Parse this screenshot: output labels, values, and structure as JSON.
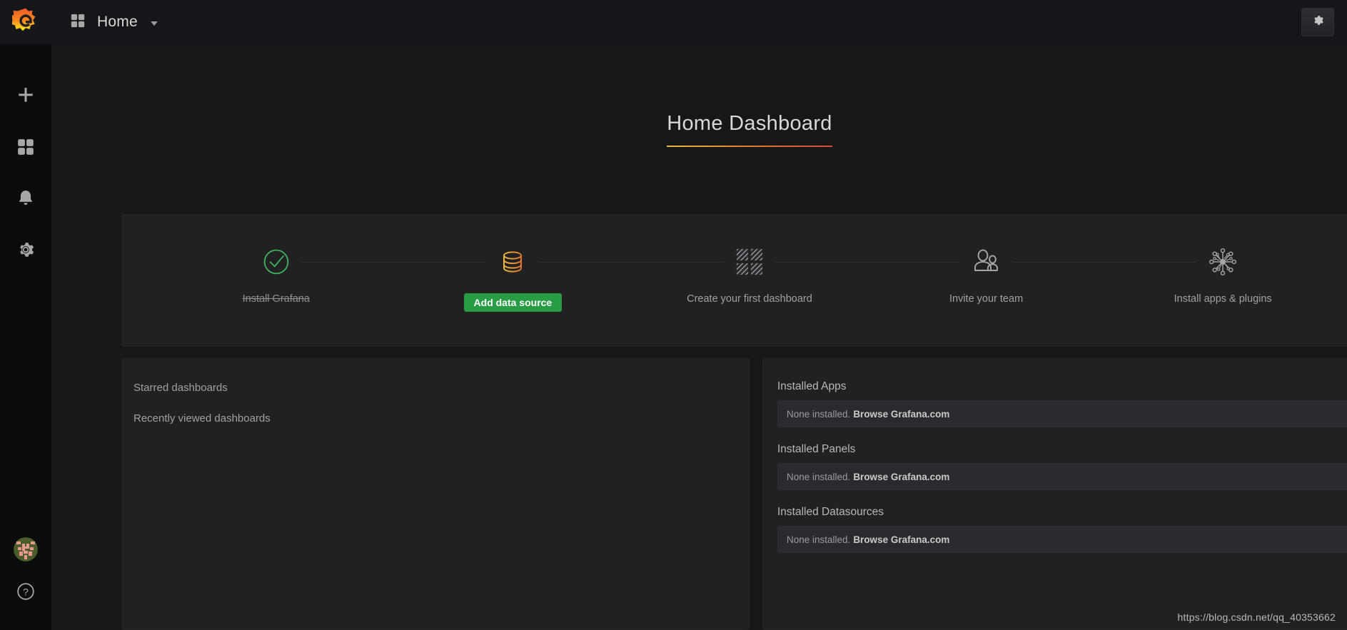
{
  "sidebar": {
    "brand_icon": "grafana-logo",
    "top_items": [
      {
        "icon": "plus-icon",
        "name": "create"
      },
      {
        "icon": "dashboards-grid-icon",
        "name": "dashboards"
      },
      {
        "icon": "bell-icon",
        "name": "alerting"
      },
      {
        "icon": "gear-icon",
        "name": "configuration"
      }
    ],
    "bottom_items": [
      {
        "icon": "user-avatar",
        "name": "profile"
      },
      {
        "icon": "help-question-icon",
        "name": "help"
      }
    ]
  },
  "topbar": {
    "menu_icon": "dashboards-grid-icon",
    "title": "Home",
    "caret_icon": "chevron-down-icon",
    "settings_icon": "gear-icon"
  },
  "title_panel": {
    "title": "Home Dashboard",
    "accent_start": "#eab839",
    "accent_end": "#d44a3a"
  },
  "onboarding": {
    "close_label": "✖",
    "steps": [
      {
        "label": "Install Grafana",
        "icon": "check-circle-icon",
        "state": "done",
        "color": "#3eb15b"
      },
      {
        "label": "Add data source",
        "icon": "database-icon",
        "state": "button",
        "color": "#e8922a"
      },
      {
        "label": "Create your first dashboard",
        "icon": "dashboard-grid-hatched-icon",
        "state": "todo",
        "color": "#a6a7a9"
      },
      {
        "label": "Invite your team",
        "icon": "users-icon",
        "state": "todo",
        "color": "#a6a7a9"
      },
      {
        "label": "Install apps & plugins",
        "icon": "plugins-node-icon",
        "state": "todo",
        "color": "#a6a7a9"
      }
    ]
  },
  "left_panel": {
    "links": [
      "Starred dashboards",
      "Recently viewed dashboards"
    ]
  },
  "right_panel": {
    "sections": [
      {
        "heading": "Installed Apps",
        "text": "None installed.",
        "link": "Browse Grafana.com"
      },
      {
        "heading": "Installed Panels",
        "text": "None installed.",
        "link": "Browse Grafana.com"
      },
      {
        "heading": "Installed Datasources",
        "text": "None installed.",
        "link": "Browse Grafana.com"
      }
    ]
  },
  "watermark": "https://blog.csdn.net/qq_40353662"
}
